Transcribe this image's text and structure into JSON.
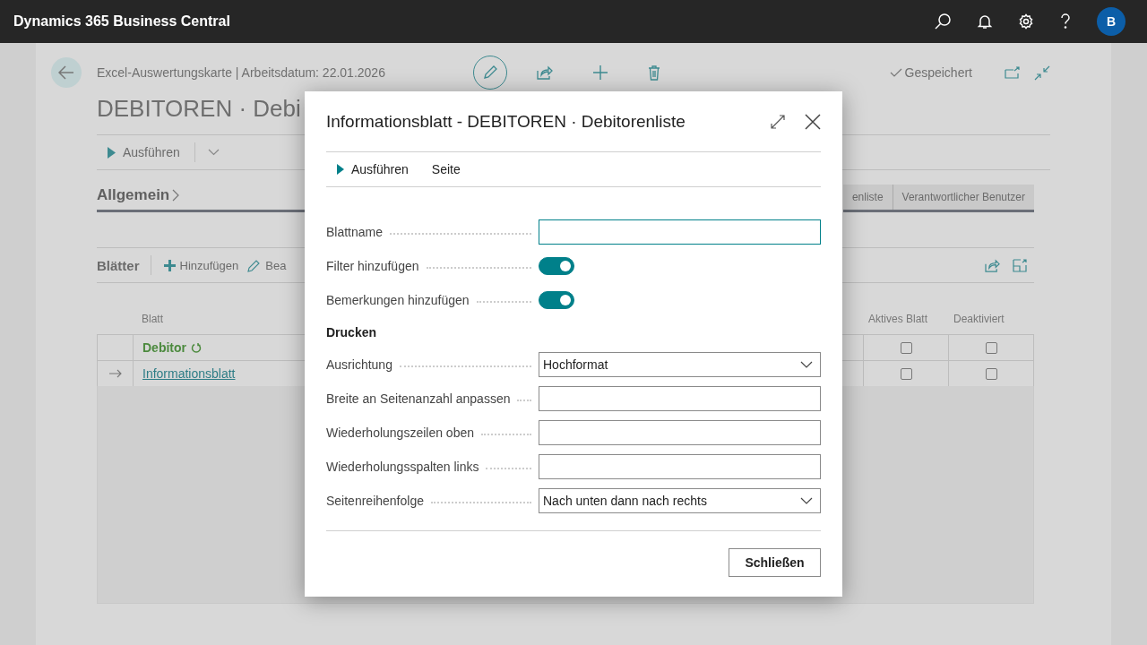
{
  "top_bar": {
    "title": "Dynamics 365 Business Central",
    "avatar": "B"
  },
  "page": {
    "breadcrumb": "Excel-Auswertungskarte | Arbeitsdatum: 22.01.2026",
    "title": "DEBITOREN · Debi",
    "saved": "Gespeichert",
    "action": "Ausführen",
    "section": "Allgemein",
    "tabs": [
      {
        "label": "enliste",
        "selected": false
      },
      {
        "label": "Verantwortlicher Benutzer",
        "selected": false
      }
    ]
  },
  "sheets": {
    "title": "Blätter",
    "actions": [
      {
        "kind": "add",
        "label": "Hinzufügen"
      },
      {
        "kind": "edit",
        "label": "Bea"
      }
    ],
    "columns": [
      "Blatt",
      "Aktives Blatt",
      "Deaktiviert"
    ],
    "rows": [
      {
        "kind": "group",
        "name": "Debitor",
        "current": false,
        "active_sheet": false,
        "deactivated": false
      },
      {
        "kind": "link",
        "name": "Informationsblatt",
        "current": true,
        "active_sheet": false,
        "deactivated": false
      }
    ]
  },
  "dialog": {
    "title": "Informationsblatt - DEBITOREN · Debitorenliste",
    "toolbar": [
      {
        "kind": "run",
        "label": "Ausführen"
      },
      {
        "kind": "plain",
        "label": "Seite"
      }
    ],
    "fields": [
      {
        "kind": "text",
        "label": "Blattname",
        "focused": true
      },
      {
        "kind": "toggle",
        "label": "Filter hinzufügen",
        "on": true
      },
      {
        "kind": "toggle",
        "label": "Bemerkungen hinzufügen",
        "on": true
      },
      {
        "kind": "heading",
        "label": "Drucken"
      },
      {
        "kind": "select",
        "label": "Ausrichtung",
        "value": "Hochformat",
        "focused": false
      },
      {
        "kind": "text",
        "label": "Breite an Seitenanzahl anpassen",
        "focused": false
      },
      {
        "kind": "text",
        "label": "Wiederholungszeilen oben",
        "focused": false
      },
      {
        "kind": "text",
        "label": "Wiederholungsspalten links",
        "focused": false
      },
      {
        "kind": "select",
        "label": "Seitenreihenfolge",
        "value": "Nach unten dann nach rechts",
        "focused": false
      }
    ],
    "button": "Schließen"
  }
}
